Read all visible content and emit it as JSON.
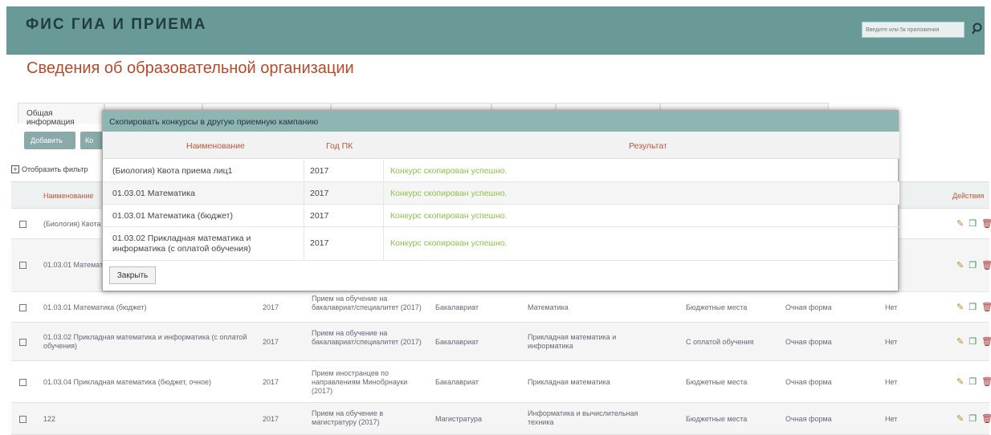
{
  "app": {
    "title": "ФИС ГИА И ПРИЕМА",
    "search_placeholder": "Введите или 5к приложения"
  },
  "page": {
    "title": "Сведения об образовательной организации"
  },
  "tabs": [
    "Общая информация",
    "",
    "",
    "",
    "",
    "",
    "",
    ""
  ],
  "toolbar": {
    "add": "Добавить",
    "second": "Ко"
  },
  "filter": {
    "label": "Отобразить фильтр"
  },
  "table": {
    "headers": {
      "name": "Наименование",
      "actions": "Действия"
    },
    "rows": [
      {
        "name": "(Биология) Квота приема лиц1",
        "year": "",
        "campaign": "",
        "level": "",
        "direction": "",
        "source": "",
        "form": "",
        "flag": ""
      },
      {
        "name": "01.03.01 Математика",
        "year": "",
        "campaign": "",
        "level": "",
        "direction": "",
        "source": "",
        "form": "",
        "flag": ""
      },
      {
        "name": "01.03.01 Математика (бюджет)",
        "year": "2017",
        "campaign": "Прием на обучение на бакалавриат/специалитет (2017)",
        "level": "Бакалавриат",
        "direction": "Математика",
        "source": "Бюджетные места",
        "form": "Очная форма",
        "flag": "Нет"
      },
      {
        "name": "01.03.02 Прикладная математика и информатика (с оплатой обучения)",
        "year": "2017",
        "campaign": "Прием на обучение на бакалавриат/специалитет (2017)",
        "level": "Бакалавриат",
        "direction": "Прикладная математика и информатика",
        "source": "С оплатой обучения",
        "form": "Очная форма",
        "flag": "Нет"
      },
      {
        "name": "01.03.04 Прикладная математика (бюджет, очное)",
        "year": "2017",
        "campaign": "Прием иностранцев по направлениям Минобрнауки (2017)",
        "level": "Бакалавриат",
        "direction": "Прикладная математика",
        "source": "Бюджетные места",
        "form": "Очная форма",
        "flag": "Нет"
      },
      {
        "name": "122",
        "year": "2017",
        "campaign": "Прием на обучение в магистратуру (2017)",
        "level": "Магистратура",
        "direction": "Информатика и вычислительная техника",
        "source": "Бюджетные места",
        "form": "Очная форма",
        "flag": "Нет"
      }
    ]
  },
  "modal": {
    "title": "Скопировать конкурсы в другую приемную кампанию",
    "headers": {
      "name": "Наименование",
      "year": "Год ПК",
      "result": "Результат"
    },
    "rows": [
      {
        "name": "(Биология) Квота приема лиц1",
        "year": "2017",
        "result": "Конкурс скопирован успешно."
      },
      {
        "name": "01.03.01 Математика",
        "year": "2017",
        "result": "Конкурс скопирован успешно."
      },
      {
        "name": "01.03.01 Математика (бюджет)",
        "year": "2017",
        "result": "Конкурс скопирован успешно."
      },
      {
        "name": "01.03.02 Прикладная математика и информатика (с оплатой обучения)",
        "year": "2017",
        "result": "Конкурс скопирован успешно."
      }
    ],
    "close": "Закрыть"
  },
  "colors": {
    "header": "#6a9a98",
    "modal_header": "#8fb5b3",
    "title": "#b54a2a",
    "success": "#8bc34a"
  }
}
